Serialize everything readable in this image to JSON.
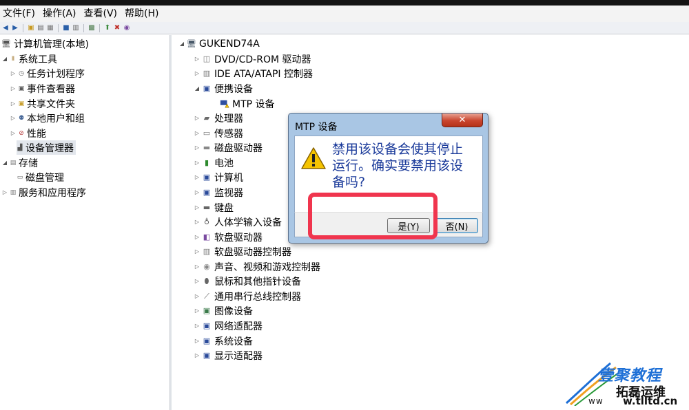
{
  "menu": {
    "items": [
      "文件(F)",
      "操作(A)",
      "查看(V)",
      "帮助(H)"
    ]
  },
  "left_tree": {
    "items": [
      {
        "label": "计算机管理(本地)",
        "icon": "computer-management-icon",
        "level": 0,
        "expander": "none"
      },
      {
        "label": "系统工具",
        "icon": "tools-icon",
        "level": 1,
        "expander": "expanded"
      },
      {
        "label": "任务计划程序",
        "icon": "clock-icon",
        "level": 2,
        "expander": "collapsed"
      },
      {
        "label": "事件查看器",
        "icon": "event-viewer-icon",
        "level": 2,
        "expander": "collapsed"
      },
      {
        "label": "共享文件夹",
        "icon": "shared-folder-icon",
        "level": 2,
        "expander": "collapsed"
      },
      {
        "label": "本地用户和组",
        "icon": "users-icon",
        "level": 2,
        "expander": "collapsed"
      },
      {
        "label": "性能",
        "icon": "performance-icon",
        "level": 2,
        "expander": "collapsed"
      },
      {
        "label": "设备管理器",
        "icon": "device-manager-icon",
        "level": 2,
        "expander": "none",
        "selected": true
      },
      {
        "label": "存储",
        "icon": "storage-icon",
        "level": 1,
        "expander": "expanded"
      },
      {
        "label": "磁盘管理",
        "icon": "disk-management-icon",
        "level": 2,
        "expander": "none"
      },
      {
        "label": "服务和应用程序",
        "icon": "services-icon",
        "level": 1,
        "expander": "collapsed"
      }
    ]
  },
  "device_tree": {
    "root": "GUKEND74A",
    "items": [
      {
        "label": "DVD/CD-ROM 驱动器",
        "icon": "dvd-drive-icon",
        "expander": "collapsed"
      },
      {
        "label": "IDE ATA/ATAPI 控制器",
        "icon": "ide-controller-icon",
        "expander": "collapsed"
      },
      {
        "label": "便携设备",
        "icon": "portable-device-icon",
        "expander": "expanded"
      },
      {
        "label": "MTP 设备",
        "icon": "mtp-device-warning-icon",
        "expander": "child"
      },
      {
        "label": "处理器",
        "icon": "processor-icon",
        "expander": "collapsed"
      },
      {
        "label": "传感器",
        "icon": "sensor-icon",
        "expander": "collapsed"
      },
      {
        "label": "磁盘驱动器",
        "icon": "disk-drive-icon",
        "expander": "collapsed"
      },
      {
        "label": "电池",
        "icon": "battery-icon",
        "expander": "collapsed"
      },
      {
        "label": "计算机",
        "icon": "computer-icon",
        "expander": "collapsed"
      },
      {
        "label": "监视器",
        "icon": "monitor-icon",
        "expander": "collapsed"
      },
      {
        "label": "键盘",
        "icon": "keyboard-icon",
        "expander": "collapsed"
      },
      {
        "label": "人体学输入设备",
        "icon": "hid-icon",
        "expander": "collapsed"
      },
      {
        "label": "软盘驱动器",
        "icon": "floppy-drive-icon",
        "expander": "collapsed"
      },
      {
        "label": "软盘驱动器控制器",
        "icon": "floppy-controller-icon",
        "expander": "collapsed"
      },
      {
        "label": "声音、视频和游戏控制器",
        "icon": "sound-icon",
        "expander": "collapsed"
      },
      {
        "label": "鼠标和其他指针设备",
        "icon": "mouse-icon",
        "expander": "collapsed"
      },
      {
        "label": "通用串行总线控制器",
        "icon": "usb-icon",
        "expander": "collapsed"
      },
      {
        "label": "图像设备",
        "icon": "imaging-icon",
        "expander": "collapsed"
      },
      {
        "label": "网络适配器",
        "icon": "network-adapter-icon",
        "expander": "collapsed"
      },
      {
        "label": "系统设备",
        "icon": "system-device-icon",
        "expander": "collapsed"
      },
      {
        "label": "显示适配器",
        "icon": "display-adapter-icon",
        "expander": "collapsed"
      }
    ]
  },
  "dialog": {
    "title": "MTP 设备",
    "message_lines": [
      "禁用该设备会使其停止",
      "运行。确实要禁用该设",
      "备吗?"
    ],
    "yes_label": "是(Y)",
    "no_label": "否(N)",
    "close_glyph": "✕"
  },
  "watermark": {
    "line1": "壹聚教程",
    "line2": "拓磊运维",
    "url_prefix": "ww",
    "url_tail": "w.tlltd.cn"
  },
  "colors": {
    "highlight": "#f0354e",
    "dialog_message": "#1a3a9a",
    "dialog_frame": "#a9c6e4"
  }
}
